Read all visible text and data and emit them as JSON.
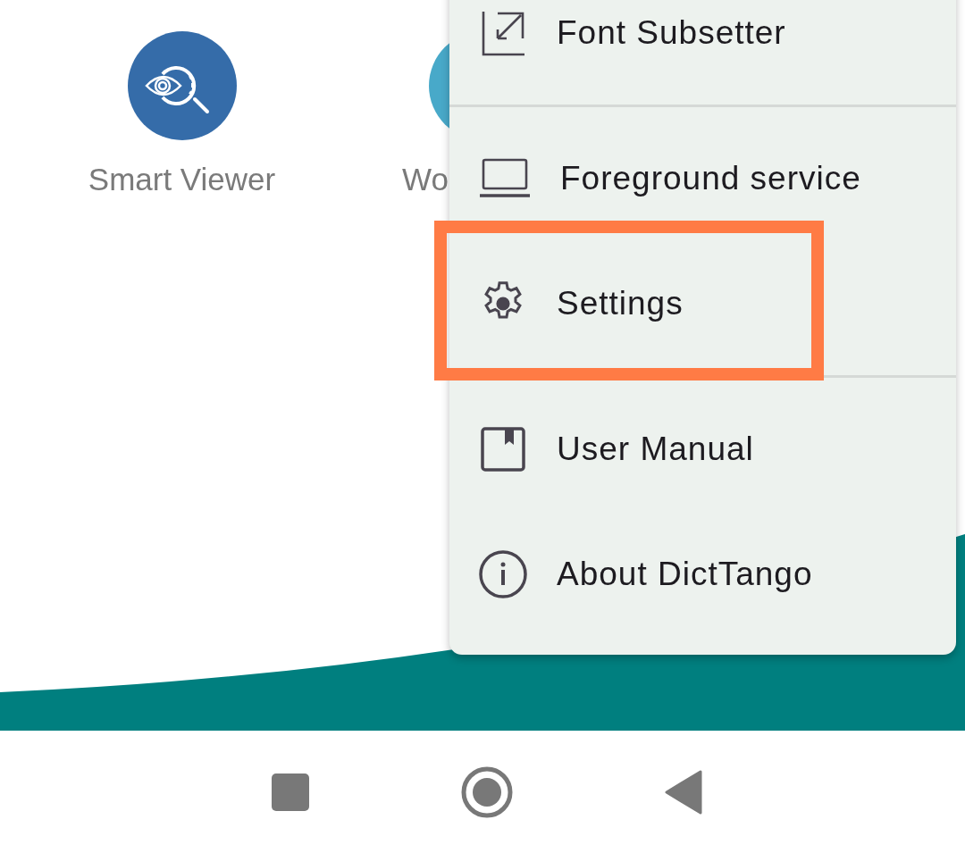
{
  "apps": [
    {
      "label": "Smart Viewer",
      "kind": "full",
      "color": "#356ca9"
    },
    {
      "label": "Wo",
      "kind": "cut",
      "color": "#48a9c9"
    }
  ],
  "menu": {
    "items": [
      {
        "label": "Font Subsetter",
        "kind": "export",
        "highlighted": false,
        "divider_after": true
      },
      {
        "label": "Foreground service",
        "kind": "laptop",
        "highlighted": false,
        "divider_after": false
      },
      {
        "label": "Settings",
        "kind": "gear",
        "highlighted": true,
        "divider_after": true
      },
      {
        "label": "User Manual",
        "kind": "book",
        "highlighted": false,
        "divider_after": false
      },
      {
        "label": "About DictTango",
        "kind": "info",
        "highlighted": false,
        "divider_after": false
      }
    ]
  }
}
